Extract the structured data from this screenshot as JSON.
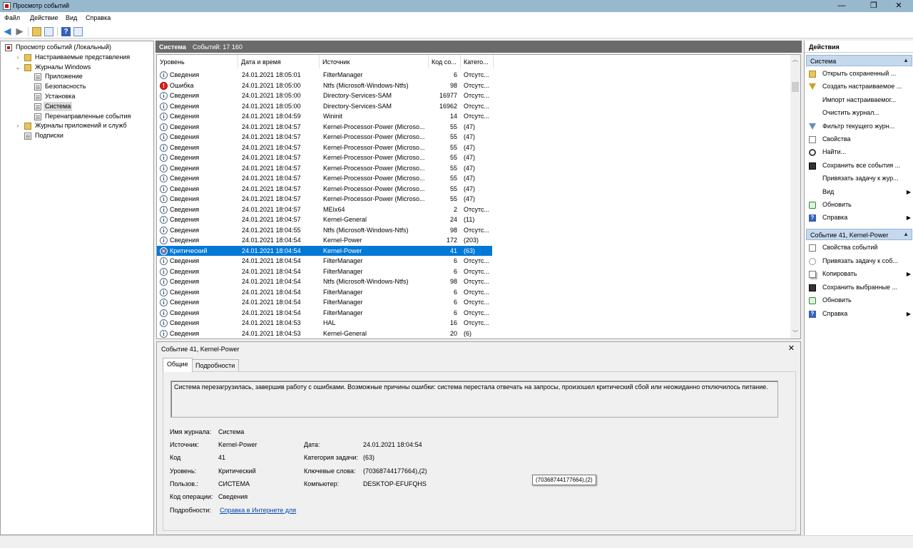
{
  "window": {
    "title": "Просмотр событий",
    "controls": {
      "minimize": "—",
      "maximize": "❐",
      "close": "✕"
    }
  },
  "menu": [
    "Файл",
    "Действие",
    "Вид",
    "Справка"
  ],
  "tree": [
    {
      "label": "Просмотр событий (Локальный)",
      "icon": "event-viewer-icon",
      "expander": ""
    },
    {
      "label": "Настраиваемые представления",
      "icon": "folder-icon",
      "expander": "›"
    },
    {
      "label": "Журналы Windows",
      "icon": "folder-icon",
      "expander": "⌄"
    },
    {
      "label": "Приложение",
      "icon": "log-icon",
      "expander": ""
    },
    {
      "label": "Безопасность",
      "icon": "log-icon",
      "expander": ""
    },
    {
      "label": "Установка",
      "icon": "log-icon",
      "expander": ""
    },
    {
      "label": "Система",
      "icon": "log-icon",
      "expander": "",
      "selected": true
    },
    {
      "label": "Перенаправленные события",
      "icon": "log-icon",
      "expander": ""
    },
    {
      "label": "Журналы приложений и служб",
      "icon": "folder-icon",
      "expander": "›"
    },
    {
      "label": "Подписки",
      "icon": "log-icon",
      "expander": ""
    }
  ],
  "center": {
    "title": "Система",
    "count_text": "Событий: 17 160"
  },
  "grid": {
    "headers": [
      "Уровень",
      "Дата и время",
      "Источник",
      "Код со...",
      "Катего..."
    ],
    "rows": [
      {
        "level": "Сведения",
        "type": "info",
        "date": "24.01.2021 18:05:01",
        "source": "FilterManager",
        "code": "6",
        "cat": "Отсутс..."
      },
      {
        "level": "Ошибка",
        "type": "err",
        "date": "24.01.2021 18:05:00",
        "source": "Ntfs (Microsoft-Windows-Ntfs)",
        "code": "98",
        "cat": "Отсутс..."
      },
      {
        "level": "Сведения",
        "type": "info",
        "date": "24.01.2021 18:05:00",
        "source": "Directory-Services-SAM",
        "code": "16977",
        "cat": "Отсутс..."
      },
      {
        "level": "Сведения",
        "type": "info",
        "date": "24.01.2021 18:05:00",
        "source": "Directory-Services-SAM",
        "code": "16962",
        "cat": "Отсутс..."
      },
      {
        "level": "Сведения",
        "type": "info",
        "date": "24.01.2021 18:04:59",
        "source": "Wininit",
        "code": "14",
        "cat": "Отсутс..."
      },
      {
        "level": "Сведения",
        "type": "info",
        "date": "24.01.2021 18:04:57",
        "source": "Kernel-Processor-Power (Microso...",
        "code": "55",
        "cat": "(47)"
      },
      {
        "level": "Сведения",
        "type": "info",
        "date": "24.01.2021 18:04:57",
        "source": "Kernel-Processor-Power (Microso...",
        "code": "55",
        "cat": "(47)"
      },
      {
        "level": "Сведения",
        "type": "info",
        "date": "24.01.2021 18:04:57",
        "source": "Kernel-Processor-Power (Microso...",
        "code": "55",
        "cat": "(47)"
      },
      {
        "level": "Сведения",
        "type": "info",
        "date": "24.01.2021 18:04:57",
        "source": "Kernel-Processor-Power (Microso...",
        "code": "55",
        "cat": "(47)"
      },
      {
        "level": "Сведения",
        "type": "info",
        "date": "24.01.2021 18:04:57",
        "source": "Kernel-Processor-Power (Microso...",
        "code": "55",
        "cat": "(47)"
      },
      {
        "level": "Сведения",
        "type": "info",
        "date": "24.01.2021 18:04:57",
        "source": "Kernel-Processor-Power (Microso...",
        "code": "55",
        "cat": "(47)"
      },
      {
        "level": "Сведения",
        "type": "info",
        "date": "24.01.2021 18:04:57",
        "source": "Kernel-Processor-Power (Microso...",
        "code": "55",
        "cat": "(47)"
      },
      {
        "level": "Сведения",
        "type": "info",
        "date": "24.01.2021 18:04:57",
        "source": "Kernel-Processor-Power (Microso...",
        "code": "55",
        "cat": "(47)"
      },
      {
        "level": "Сведения",
        "type": "info",
        "date": "24.01.2021 18:04:57",
        "source": "MEIx64",
        "code": "2",
        "cat": "Отсутс..."
      },
      {
        "level": "Сведения",
        "type": "info",
        "date": "24.01.2021 18:04:57",
        "source": "Kernel-General",
        "code": "24",
        "cat": "(11)"
      },
      {
        "level": "Сведения",
        "type": "info",
        "date": "24.01.2021 18:04:55",
        "source": "Ntfs (Microsoft-Windows-Ntfs)",
        "code": "98",
        "cat": "Отсутс..."
      },
      {
        "level": "Сведения",
        "type": "info",
        "date": "24.01.2021 18:04:54",
        "source": "Kernel-Power",
        "code": "172",
        "cat": "(203)"
      },
      {
        "level": "Критический",
        "type": "crit",
        "date": "24.01.2021 18:04:54",
        "source": "Kernel-Power",
        "code": "41",
        "cat": "(63)",
        "selected": true
      },
      {
        "level": "Сведения",
        "type": "info",
        "date": "24.01.2021 18:04:54",
        "source": "FilterManager",
        "code": "6",
        "cat": "Отсутс..."
      },
      {
        "level": "Сведения",
        "type": "info",
        "date": "24.01.2021 18:04:54",
        "source": "FilterManager",
        "code": "6",
        "cat": "Отсутс..."
      },
      {
        "level": "Сведения",
        "type": "info",
        "date": "24.01.2021 18:04:54",
        "source": "Ntfs (Microsoft-Windows-Ntfs)",
        "code": "98",
        "cat": "Отсутс..."
      },
      {
        "level": "Сведения",
        "type": "info",
        "date": "24.01.2021 18:04:54",
        "source": "FilterManager",
        "code": "6",
        "cat": "Отсутс..."
      },
      {
        "level": "Сведения",
        "type": "info",
        "date": "24.01.2021 18:04:54",
        "source": "FilterManager",
        "code": "6",
        "cat": "Отсутс..."
      },
      {
        "level": "Сведения",
        "type": "info",
        "date": "24.01.2021 18:04:54",
        "source": "FilterManager",
        "code": "6",
        "cat": "Отсутс..."
      },
      {
        "level": "Сведения",
        "type": "info",
        "date": "24.01.2021 18:04:53",
        "source": "HAL",
        "code": "16",
        "cat": "Отсутс..."
      },
      {
        "level": "Сведения",
        "type": "info",
        "date": "24.01.2021 18:04:53",
        "source": "Kernel-General",
        "code": "20",
        "cat": "(6)"
      }
    ]
  },
  "detail": {
    "title": "Событие 41, Kernel-Power",
    "close": "✕",
    "tabs": [
      "Общие",
      "Подробности"
    ],
    "message": "Система перезагрузилась, завершив работу с ошибками. Возможные причины ошибки: система перестала отвечать на запросы, произошел критический сбой или неожиданно отключилось питание.",
    "fields": {
      "log_name_label": "Имя журнала:",
      "log_name": "Система",
      "source_label": "Источник:",
      "source": "Kernel-Power",
      "date_label": "Дата:",
      "date": "24.01.2021 18:04:54",
      "code_label": "Код",
      "code": "41",
      "task_label": "Категория задачи:",
      "task": "(63)",
      "level_label": "Уровень:",
      "level": "Критический",
      "keywords_label": "Ключевые слова:",
      "keywords": "(70368744177664),(2)",
      "user_label": "Пользов.:",
      "user": "СИСТЕМА",
      "computer_label": "Компьютер:",
      "computer": "DESKTOP-EFUFQHS",
      "opcode_label": "Код операции:",
      "opcode": "Сведения",
      "more_label": "Подробности:",
      "more_link": "Справка в Интернете для"
    },
    "tooltip": "(70368744177664),(2)"
  },
  "actions": {
    "title": "Действия",
    "section1": "Система",
    "items1": [
      {
        "label": "Открыть сохраненный ...",
        "icon": "folder-icon",
        "submenu": ""
      },
      {
        "label": "Создать настраиваемое ...",
        "icon": "filter-icon",
        "submenu": ""
      },
      {
        "label": "Импорт настраиваемог...",
        "icon": "",
        "submenu": ""
      },
      {
        "label": "Очистить журнал...",
        "icon": "",
        "submenu": ""
      },
      {
        "label": "Фильтр текущего журн...",
        "icon": "filter-icon",
        "submenu": ""
      },
      {
        "label": "Свойства",
        "icon": "properties-icon",
        "submenu": ""
      },
      {
        "label": "Найти...",
        "icon": "find-icon",
        "submenu": ""
      },
      {
        "label": "Сохранить все события ...",
        "icon": "save-icon",
        "submenu": ""
      },
      {
        "label": "Привязать задачу к жур...",
        "icon": "",
        "submenu": ""
      },
      {
        "label": "Вид",
        "icon": "",
        "submenu": "▶"
      },
      {
        "label": "Обновить",
        "icon": "refresh-icon",
        "submenu": ""
      },
      {
        "label": "Справка",
        "icon": "help-icon",
        "submenu": "▶"
      }
    ],
    "section2": "Событие 41, Kernel-Power",
    "items2": [
      {
        "label": "Свойства событий",
        "icon": "properties-icon",
        "submenu": ""
      },
      {
        "label": "Привязать задачу к соб...",
        "icon": "task-icon",
        "submenu": ""
      },
      {
        "label": "Копировать",
        "icon": "copy-icon",
        "submenu": "▶"
      },
      {
        "label": "Сохранить выбранные ...",
        "icon": "save-icon",
        "submenu": ""
      },
      {
        "label": "Обновить",
        "icon": "refresh-icon",
        "submenu": ""
      },
      {
        "label": "Справка",
        "icon": "help-icon",
        "submenu": "▶"
      }
    ]
  }
}
